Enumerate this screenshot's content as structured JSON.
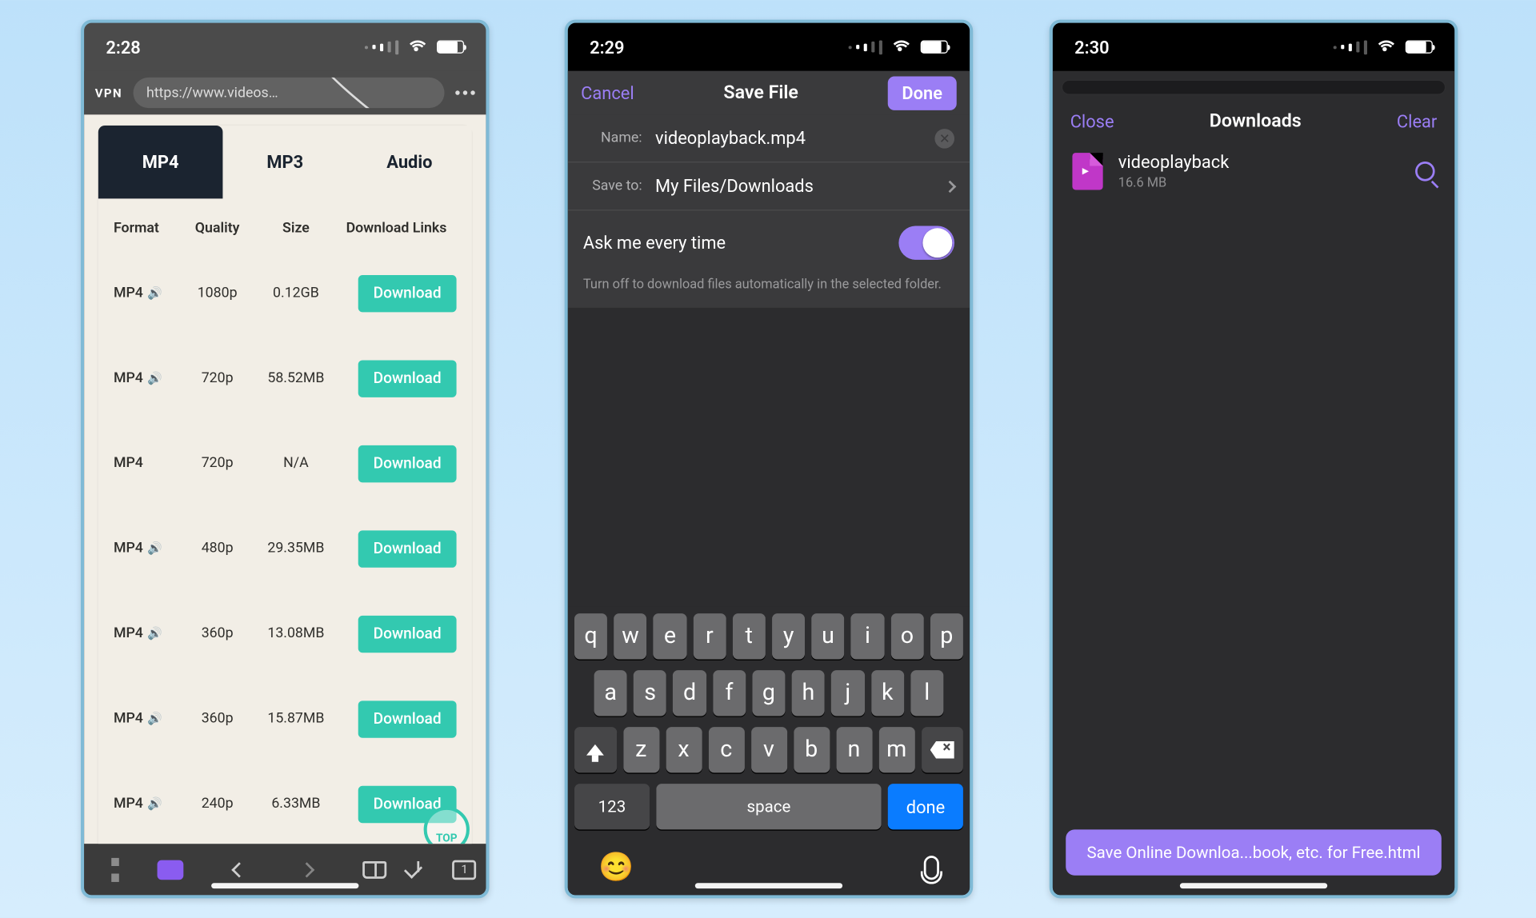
{
  "phone1": {
    "time": "2:28",
    "vpn": "VPN",
    "url": "https://www.videosolo.com/onlin...",
    "tabs": [
      "MP4",
      "MP3",
      "Audio"
    ],
    "columns": {
      "format": "Format",
      "quality": "Quality",
      "size": "Size",
      "links": "Download Links"
    },
    "rows": [
      {
        "format": "MP4",
        "audio": true,
        "quality": "1080p",
        "size": "0.12GB",
        "btn": "Download"
      },
      {
        "format": "MP4",
        "audio": true,
        "quality": "720p",
        "size": "58.52MB",
        "btn": "Download"
      },
      {
        "format": "MP4",
        "audio": false,
        "quality": "720p",
        "size": "N/A",
        "btn": "Download"
      },
      {
        "format": "MP4",
        "audio": true,
        "quality": "480p",
        "size": "29.35MB",
        "btn": "Download"
      },
      {
        "format": "MP4",
        "audio": true,
        "quality": "360p",
        "size": "13.08MB",
        "btn": "Download"
      },
      {
        "format": "MP4",
        "audio": true,
        "quality": "360p",
        "size": "15.87MB",
        "btn": "Download"
      },
      {
        "format": "MP4",
        "audio": true,
        "quality": "240p",
        "size": "6.33MB",
        "btn": "Download"
      }
    ],
    "badge": "TOP",
    "tabcount": "1"
  },
  "phone2": {
    "time": "2:29",
    "cancel": "Cancel",
    "title": "Save File",
    "done": "Done",
    "name_label": "Name:",
    "name_value": "videoplayback.mp4",
    "saveto_label": "Save to:",
    "saveto_value": "My Files/Downloads",
    "toggle_label": "Ask me every time",
    "hint": "Turn off to download files automatically in the selected folder.",
    "kbd": {
      "r1": [
        "q",
        "w",
        "e",
        "r",
        "t",
        "y",
        "u",
        "i",
        "o",
        "p"
      ],
      "r2": [
        "a",
        "s",
        "d",
        "f",
        "g",
        "h",
        "j",
        "k",
        "l"
      ],
      "r3": [
        "z",
        "x",
        "c",
        "v",
        "b",
        "n",
        "m"
      ],
      "num": "123",
      "space": "space",
      "done": "done"
    }
  },
  "phone3": {
    "time": "2:30",
    "close": "Close",
    "title": "Downloads",
    "clear": "Clear",
    "file": {
      "name": "videoplayback",
      "size": "16.6 MB"
    },
    "toast": "Save Online Downloa...book, etc. for Free.html"
  }
}
